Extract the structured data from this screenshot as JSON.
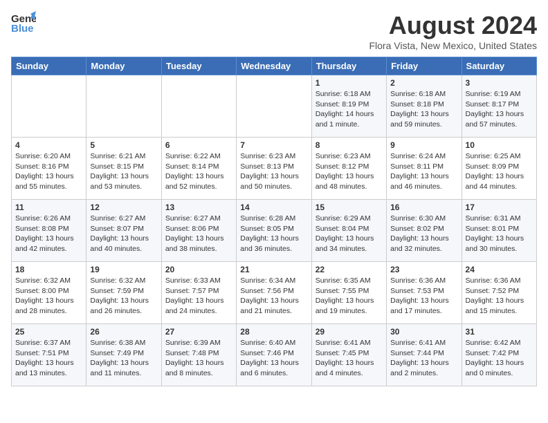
{
  "header": {
    "logo_line1": "General",
    "logo_line2": "Blue",
    "month_title": "August 2024",
    "location": "Flora Vista, New Mexico, United States"
  },
  "weekdays": [
    "Sunday",
    "Monday",
    "Tuesday",
    "Wednesday",
    "Thursday",
    "Friday",
    "Saturday"
  ],
  "weeks": [
    [
      {
        "day": "",
        "info": ""
      },
      {
        "day": "",
        "info": ""
      },
      {
        "day": "",
        "info": ""
      },
      {
        "day": "",
        "info": ""
      },
      {
        "day": "1",
        "info": "Sunrise: 6:18 AM\nSunset: 8:19 PM\nDaylight: 14 hours\nand 1 minute."
      },
      {
        "day": "2",
        "info": "Sunrise: 6:18 AM\nSunset: 8:18 PM\nDaylight: 13 hours\nand 59 minutes."
      },
      {
        "day": "3",
        "info": "Sunrise: 6:19 AM\nSunset: 8:17 PM\nDaylight: 13 hours\nand 57 minutes."
      }
    ],
    [
      {
        "day": "4",
        "info": "Sunrise: 6:20 AM\nSunset: 8:16 PM\nDaylight: 13 hours\nand 55 minutes."
      },
      {
        "day": "5",
        "info": "Sunrise: 6:21 AM\nSunset: 8:15 PM\nDaylight: 13 hours\nand 53 minutes."
      },
      {
        "day": "6",
        "info": "Sunrise: 6:22 AM\nSunset: 8:14 PM\nDaylight: 13 hours\nand 52 minutes."
      },
      {
        "day": "7",
        "info": "Sunrise: 6:23 AM\nSunset: 8:13 PM\nDaylight: 13 hours\nand 50 minutes."
      },
      {
        "day": "8",
        "info": "Sunrise: 6:23 AM\nSunset: 8:12 PM\nDaylight: 13 hours\nand 48 minutes."
      },
      {
        "day": "9",
        "info": "Sunrise: 6:24 AM\nSunset: 8:11 PM\nDaylight: 13 hours\nand 46 minutes."
      },
      {
        "day": "10",
        "info": "Sunrise: 6:25 AM\nSunset: 8:09 PM\nDaylight: 13 hours\nand 44 minutes."
      }
    ],
    [
      {
        "day": "11",
        "info": "Sunrise: 6:26 AM\nSunset: 8:08 PM\nDaylight: 13 hours\nand 42 minutes."
      },
      {
        "day": "12",
        "info": "Sunrise: 6:27 AM\nSunset: 8:07 PM\nDaylight: 13 hours\nand 40 minutes."
      },
      {
        "day": "13",
        "info": "Sunrise: 6:27 AM\nSunset: 8:06 PM\nDaylight: 13 hours\nand 38 minutes."
      },
      {
        "day": "14",
        "info": "Sunrise: 6:28 AM\nSunset: 8:05 PM\nDaylight: 13 hours\nand 36 minutes."
      },
      {
        "day": "15",
        "info": "Sunrise: 6:29 AM\nSunset: 8:04 PM\nDaylight: 13 hours\nand 34 minutes."
      },
      {
        "day": "16",
        "info": "Sunrise: 6:30 AM\nSunset: 8:02 PM\nDaylight: 13 hours\nand 32 minutes."
      },
      {
        "day": "17",
        "info": "Sunrise: 6:31 AM\nSunset: 8:01 PM\nDaylight: 13 hours\nand 30 minutes."
      }
    ],
    [
      {
        "day": "18",
        "info": "Sunrise: 6:32 AM\nSunset: 8:00 PM\nDaylight: 13 hours\nand 28 minutes."
      },
      {
        "day": "19",
        "info": "Sunrise: 6:32 AM\nSunset: 7:59 PM\nDaylight: 13 hours\nand 26 minutes."
      },
      {
        "day": "20",
        "info": "Sunrise: 6:33 AM\nSunset: 7:57 PM\nDaylight: 13 hours\nand 24 minutes."
      },
      {
        "day": "21",
        "info": "Sunrise: 6:34 AM\nSunset: 7:56 PM\nDaylight: 13 hours\nand 21 minutes."
      },
      {
        "day": "22",
        "info": "Sunrise: 6:35 AM\nSunset: 7:55 PM\nDaylight: 13 hours\nand 19 minutes."
      },
      {
        "day": "23",
        "info": "Sunrise: 6:36 AM\nSunset: 7:53 PM\nDaylight: 13 hours\nand 17 minutes."
      },
      {
        "day": "24",
        "info": "Sunrise: 6:36 AM\nSunset: 7:52 PM\nDaylight: 13 hours\nand 15 minutes."
      }
    ],
    [
      {
        "day": "25",
        "info": "Sunrise: 6:37 AM\nSunset: 7:51 PM\nDaylight: 13 hours\nand 13 minutes."
      },
      {
        "day": "26",
        "info": "Sunrise: 6:38 AM\nSunset: 7:49 PM\nDaylight: 13 hours\nand 11 minutes."
      },
      {
        "day": "27",
        "info": "Sunrise: 6:39 AM\nSunset: 7:48 PM\nDaylight: 13 hours\nand 8 minutes."
      },
      {
        "day": "28",
        "info": "Sunrise: 6:40 AM\nSunset: 7:46 PM\nDaylight: 13 hours\nand 6 minutes."
      },
      {
        "day": "29",
        "info": "Sunrise: 6:41 AM\nSunset: 7:45 PM\nDaylight: 13 hours\nand 4 minutes."
      },
      {
        "day": "30",
        "info": "Sunrise: 6:41 AM\nSunset: 7:44 PM\nDaylight: 13 hours\nand 2 minutes."
      },
      {
        "day": "31",
        "info": "Sunrise: 6:42 AM\nSunset: 7:42 PM\nDaylight: 13 hours\nand 0 minutes."
      }
    ]
  ]
}
